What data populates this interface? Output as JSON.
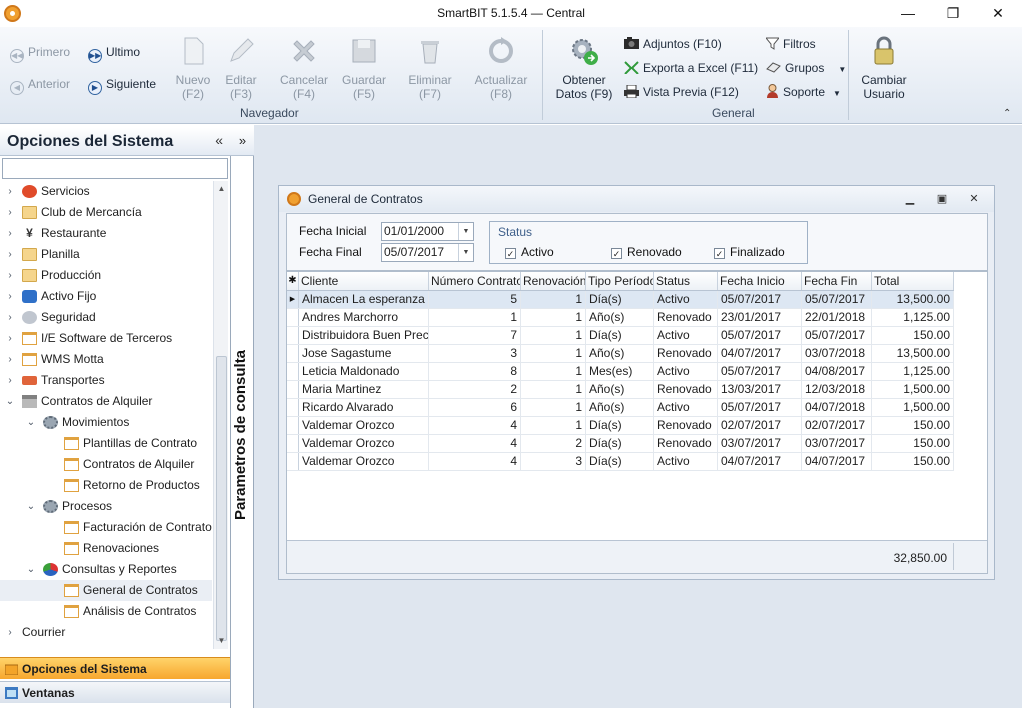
{
  "window": {
    "title": "SmartBIT 5.1.5.4 — Central",
    "minimize": "—",
    "maximize": "❐",
    "close": "✕"
  },
  "ribbon": {
    "navegador": {
      "primero": "Primero",
      "anterior": "Anterior",
      "ultimo": "Ultimo",
      "siguiente": "Siguiente",
      "nuevo": [
        "Nuevo",
        "(F2)"
      ],
      "editar": [
        "Editar",
        "(F3)"
      ],
      "cancelar": [
        "Cancelar",
        "(F4)"
      ],
      "guardar": [
        "Guardar",
        "(F5)"
      ],
      "eliminar": [
        "Eliminar",
        "(F7)"
      ],
      "actualizar": [
        "Actualizar",
        "(F8)"
      ],
      "group_label": "Navegador"
    },
    "general": {
      "obtener": [
        "Obtener",
        "Datos (F9)"
      ],
      "adjuntos": "Adjuntos (F10)",
      "exporta": "Exporta a Excel (F11)",
      "vista": "Vista Previa (F12)",
      "filtros": "Filtros",
      "grupos": "Grupos",
      "soporte": "Soporte",
      "cambiar": [
        "Cambiar",
        "Usuario"
      ],
      "group_label": "General"
    },
    "collapse_icon": "⌃"
  },
  "sidebar": {
    "title": "Opciones del Sistema",
    "collapse": "«",
    "search_placeholder": "",
    "items": [
      {
        "label": "Servicios",
        "icon": "red"
      },
      {
        "label": "Club de Mercancía",
        "icon": "folder"
      },
      {
        "label": "Restaurante",
        "icon": "fork"
      },
      {
        "label": "Planilla",
        "icon": "folder"
      },
      {
        "label": "Producción",
        "icon": "folder"
      },
      {
        "label": "Activo Fijo",
        "icon": "blue"
      },
      {
        "label": "Seguridad",
        "icon": "gray"
      },
      {
        "label": "I/E Software de Terceros",
        "icon": "doc"
      },
      {
        "label": "WMS Motta",
        "icon": "doc"
      },
      {
        "label": "Transportes",
        "icon": "truck"
      },
      {
        "label": "Contratos de Alquiler",
        "icon": "bank"
      },
      {
        "label": "Movimientos",
        "icon": "gear"
      },
      {
        "label": "Plantillas de Contrato",
        "icon": "doc"
      },
      {
        "label": "Contratos de Alquiler",
        "icon": "doc"
      },
      {
        "label": "Retorno de Productos",
        "icon": "doc"
      },
      {
        "label": "Procesos",
        "icon": "gear"
      },
      {
        "label": "Facturación de Contratos",
        "icon": "doc"
      },
      {
        "label": "Renovaciones",
        "icon": "doc"
      },
      {
        "label": "Consultas y Reportes",
        "icon": "pie"
      },
      {
        "label": "General de Contratos",
        "icon": "doc"
      },
      {
        "label": "Análisis de Contratos",
        "icon": "doc"
      },
      {
        "label": "Courrier",
        "icon": ""
      }
    ],
    "tabs": {
      "opciones": "Opciones del Sistema",
      "ventanas": "Ventanas"
    }
  },
  "vpanel": {
    "expand": "»",
    "label": "Parametros de consulta"
  },
  "child": {
    "title": "General de Contratos",
    "fecha_inicial_label": "Fecha Inicial",
    "fecha_inicial": "01/01/2000",
    "fecha_final_label": "Fecha Final",
    "fecha_final": "05/07/2017",
    "status_label": "Status",
    "chk_activo": "Activo",
    "chk_renovado": "Renovado",
    "chk_finalizado": "Finalizado",
    "check_mark": "✓",
    "columns": [
      "Cliente",
      "Número Contrato",
      "Renovación",
      "Tipo Período",
      "Status",
      "Fecha Inicio",
      "Fecha Fin",
      "Total"
    ],
    "rows": [
      [
        "Almacen La esperanza",
        "5",
        "1",
        "Día(s)",
        "Activo",
        "05/07/2017",
        "05/07/2017",
        "13,500.00"
      ],
      [
        "Andres Marchorro",
        "1",
        "1",
        "Año(s)",
        "Renovado",
        "23/01/2017",
        "22/01/2018",
        "1,125.00"
      ],
      [
        "Distribuidora Buen Precio",
        "7",
        "1",
        "Día(s)",
        "Activo",
        "05/07/2017",
        "05/07/2017",
        "150.00"
      ],
      [
        "Jose Sagastume",
        "3",
        "1",
        "Año(s)",
        "Renovado",
        "04/07/2017",
        "03/07/2018",
        "13,500.00"
      ],
      [
        "Leticia Maldonado",
        "8",
        "1",
        "Mes(es)",
        "Activo",
        "05/07/2017",
        "04/08/2017",
        "1,125.00"
      ],
      [
        "Maria Martinez",
        "2",
        "1",
        "Año(s)",
        "Renovado",
        "13/03/2017",
        "12/03/2018",
        "1,500.00"
      ],
      [
        "Ricardo Alvarado",
        "6",
        "1",
        "Año(s)",
        "Activo",
        "05/07/2017",
        "04/07/2018",
        "1,500.00"
      ],
      [
        "Valdemar Orozco",
        "4",
        "1",
        "Día(s)",
        "Renovado",
        "02/07/2017",
        "02/07/2017",
        "150.00"
      ],
      [
        "Valdemar Orozco",
        "4",
        "2",
        "Día(s)",
        "Renovado",
        "03/07/2017",
        "03/07/2017",
        "150.00"
      ],
      [
        "Valdemar Orozco",
        "4",
        "3",
        "Día(s)",
        "Activo",
        "04/07/2017",
        "04/07/2017",
        "150.00"
      ]
    ],
    "total": "32,850.00"
  }
}
